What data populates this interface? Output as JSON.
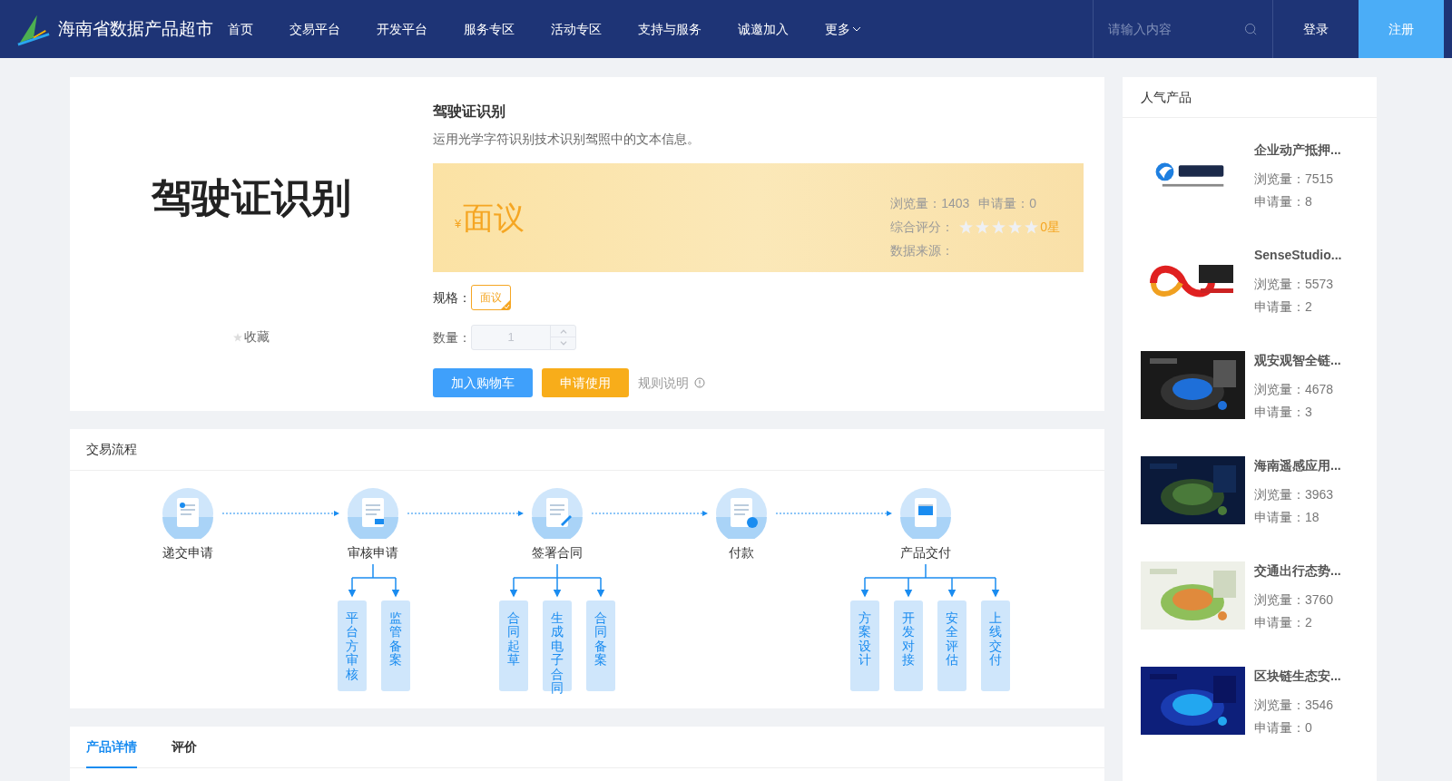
{
  "header": {
    "site_name": "海南省数据产品超市",
    "nav": [
      {
        "label": "首页"
      },
      {
        "label": "交易平台"
      },
      {
        "label": "开发平台"
      },
      {
        "label": "服务专区"
      },
      {
        "label": "活动专区"
      },
      {
        "label": "支持与服务"
      },
      {
        "label": "诚邀加入"
      },
      {
        "label": "更多",
        "dropdown": true
      }
    ],
    "search": {
      "placeholder": "请输入内容"
    },
    "login": "登录",
    "register": "注册"
  },
  "product": {
    "image_text": "驾驶证识别",
    "favorite": "收藏",
    "title": "驾驶证识别",
    "description": "运用光学字符识别技术识别驾照中的文本信息。",
    "price": {
      "currency": "¥",
      "amount": "面议"
    },
    "views": "浏览量：1403",
    "applies": "申请量：0",
    "rating_label": "综合评分：",
    "stars": 0,
    "rating_text": "0星",
    "source_label": "数据来源：",
    "spec": {
      "label": "规格：",
      "options": [
        {
          "label": "面议",
          "selected": true
        }
      ]
    },
    "quantity": {
      "label": "数量：",
      "value": "1",
      "disabled": true
    },
    "buttons": [
      {
        "label": "加入购物车",
        "kind": "primary"
      },
      {
        "label": "申请使用",
        "kind": "warning"
      }
    ],
    "rules_link": "规则说明"
  },
  "flow": {
    "title": "交易流程",
    "steps": [
      {
        "label": "递交申请"
      },
      {
        "label": "审核申请",
        "children": [
          {
            "label": "平台方审核"
          },
          {
            "label": "监管备案"
          }
        ]
      },
      {
        "label": "签署合同",
        "children": [
          {
            "label": "合同起草"
          },
          {
            "label": "生成电子合同"
          },
          {
            "label": "合同备案"
          }
        ]
      },
      {
        "label": "付款"
      },
      {
        "label": "产品交付",
        "children": [
          {
            "label": "方案设计"
          },
          {
            "label": "开发对接"
          },
          {
            "label": "安全评估"
          },
          {
            "label": "上线交付"
          }
        ]
      }
    ]
  },
  "tabs": [
    {
      "label": "产品详情",
      "selected": true
    },
    {
      "label": "评价",
      "selected": false
    }
  ],
  "popular": {
    "title": "人气产品",
    "items": [
      {
        "kind": "logo",
        "title": "企业动产抵押...",
        "views": "浏览量：7515",
        "applies": "申请量：8"
      },
      {
        "kind": "logo",
        "title": "SenseStudio...",
        "views": "浏览量：5573",
        "applies": "申请量：2"
      },
      {
        "kind": "picture",
        "title": "观安观智全链...",
        "views": "浏览量：4678",
        "applies": "申请量：3"
      },
      {
        "kind": "picture",
        "title": "海南遥感应用...",
        "views": "浏览量：3963",
        "applies": "申请量：18"
      },
      {
        "kind": "picture",
        "title": "交通出行态势...",
        "views": "浏览量：3760",
        "applies": "申请量：2"
      },
      {
        "kind": "picture",
        "title": "区块链生态安...",
        "views": "浏览量：3546",
        "applies": "申请量：0"
      }
    ]
  }
}
